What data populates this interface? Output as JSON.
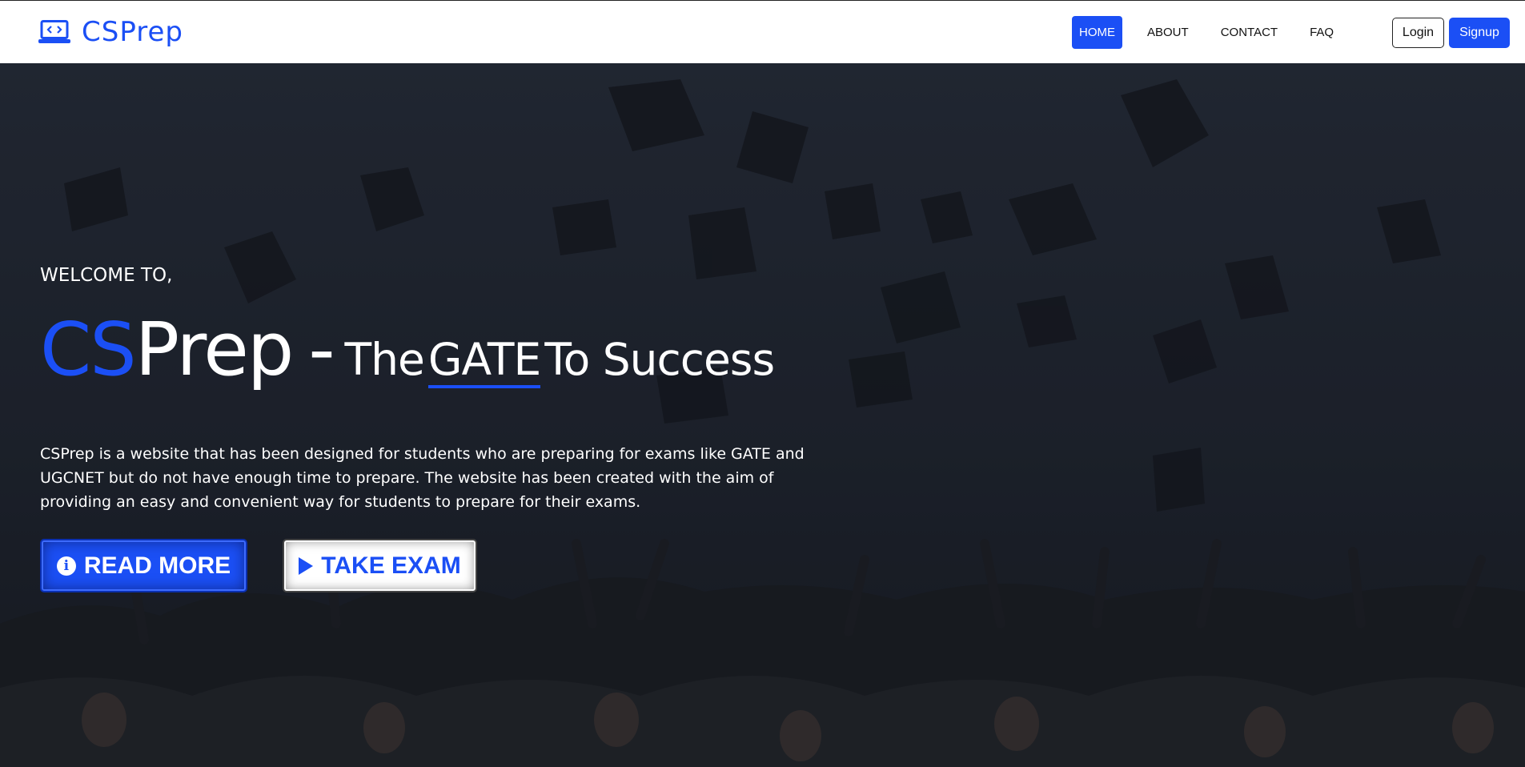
{
  "brand": {
    "name": "CSPrep",
    "accent_color": "#1b4ff5",
    "icon": "laptop-code-icon"
  },
  "nav": {
    "items": [
      {
        "label": "HOME",
        "active": true
      },
      {
        "label": "ABOUT",
        "active": false
      },
      {
        "label": "CONTACT",
        "active": false
      },
      {
        "label": "FAQ",
        "active": false
      }
    ],
    "login_label": "Login",
    "signup_label": "Signup"
  },
  "hero": {
    "welcome": "WELCOME TO,",
    "title_cs": "CS",
    "title_prep": "Prep",
    "title_dash": "-",
    "tagline_the": "The",
    "tagline_gate": "GATE",
    "tagline_rest": "To Success",
    "description": "CSPrep is a website that has been designed for students who are preparing for exams like GATE and UGCNET but do not have enough time to prepare. The website has been created with the aim of providing an easy and convenient way for students to prepare for their exams.",
    "read_more_label": "READ MORE",
    "take_exam_label": "TAKE EXAM",
    "read_more_icon": "info-circle-icon",
    "take_exam_icon": "play-icon"
  }
}
